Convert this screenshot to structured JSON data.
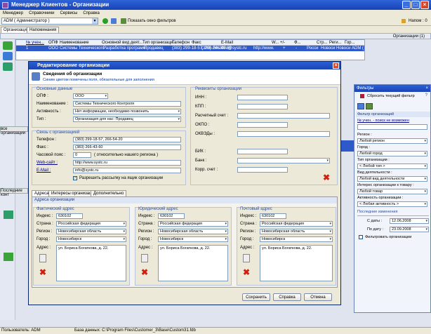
{
  "app": {
    "title": "Менеджер Клиентов - Организации"
  },
  "menu": [
    "Менеджер",
    "Справочники",
    "Сервисы",
    "Справка"
  ],
  "toolbar": {
    "user": "ADM ( Администратор )",
    "show_filters": "Показать окно фильтров",
    "naponm_label": "Напом : 0"
  },
  "tabs": [
    "Организации",
    "Напоминания"
  ],
  "strip_right": "Организации (1)",
  "grid": {
    "headers": [
      "№ учен...",
      "ОПФ",
      "Наименование",
      "Основной вид деят...",
      "Тип организаци...",
      "Телефон",
      "Факс",
      "E-Mail",
      "W...",
      "+/-",
      "Ф...",
      "Стр...",
      "Реги...",
      "Гор..."
    ],
    "row": [
      "1",
      "ООО",
      "Системы Технического",
      "Разработка программ",
      "Продавец",
      "(383) 299-18-57, 266-54-20",
      "(383) 266-43-60",
      "info@systc.ru",
      "http://www.",
      "+",
      "-",
      "Росси",
      "Новоси",
      "Новоси",
      "ADM ("
    ]
  },
  "dialog": {
    "title": "Редактирование организации",
    "head_title": "Сведения об организации",
    "head_sub": "Синим цветом помечены поля, обязательные для заполнения",
    "basic": {
      "legend": "Основные данные",
      "opf_label": "ОПФ :",
      "opf_value": "ООО",
      "name_label": "Наименование :",
      "name_value": "Системы Технического Контроля",
      "activity_label": "Активность :",
      "activity_value": "Нет информации, необходимо позвонить",
      "type_label": "Тип :",
      "type_value": "Организация для нас: Продавец"
    },
    "contact": {
      "legend": "Связь с организацией",
      "phone_label": "Телефон :",
      "phone_value": "(383) 299-18-57, 266-54-20",
      "fax_label": "Факс :",
      "fax_value": "(383) 266-43-60",
      "tz_label": "Часовой пояс :",
      "tz_value": "0",
      "tz_note": "( относительно нашего региона )",
      "web_label": "Web-сайт :",
      "web_value": "http://www.systc.ru",
      "email_label": "E-Mail :",
      "email_value": "info@systc.ru",
      "mail_allow": "Разрешить рассылку на ящик организации"
    },
    "requisites": {
      "legend": "Реквизиты организации",
      "inn": "ИНН :",
      "kpp": "КПП :",
      "account": "Расчетный счет :",
      "okpo": "ОКПО :",
      "okved": "ОКВЭДы :",
      "bik": "БИК :",
      "bank": "Банк :",
      "korr": "Корр. счет :"
    },
    "subtabs": [
      "Адреса",
      "Интересы организации",
      "Дополнительно"
    ],
    "addr_group": "Адреса организации",
    "addresses": [
      {
        "legend": "Фактический адрес",
        "index": "630102",
        "country": "Российская федерация",
        "region": "Новосибирская область",
        "city": "Новосибирск",
        "addr": "ул. Бориса Богаткова, д. 22."
      },
      {
        "legend": "Юридический адрес",
        "index": "630102",
        "country": "Российская федерация",
        "region": "Новосибирская область",
        "city": "Новосибирск",
        "addr": "ул. Бориса Богаткова, д. 22."
      },
      {
        "legend": "Почтовый адрес",
        "index": "630102",
        "country": "Российская федерация",
        "region": "Новосибирская область",
        "city": "Новосибирск",
        "addr": "ул. Бориса Богаткова, д. 22."
      }
    ],
    "addr_labels": {
      "index": "Индекс :",
      "country": "Страна :",
      "region": "Регион :",
      "city": "Город :",
      "addr": "Адрес :"
    },
    "buttons": {
      "save": "Сохранить",
      "help": "Справка",
      "cancel": "Отмена"
    }
  },
  "filters": {
    "title": "Фильтры",
    "reset": "Сбросить текущий фильтр",
    "section": "Фильтр организаций",
    "num_label": "№ учен. - поиск не возможен",
    "region_label": "Регион :",
    "region_value": "Любой регион",
    "city_label": "Город :",
    "city_value": "Любой город",
    "type_label": "Тип организации :",
    "type_value": "< Любой тип >",
    "activity_label": "Вид деятельности :",
    "activity_value": "Любой вид деятельности",
    "interest_label": "Интерес организации к товару :",
    "interest_value": "Любой товар",
    "active_label": "Активность организации :",
    "active_value": "< Любая активность >",
    "last_changes": "Последние изменения",
    "from_label": "С даты :",
    "from_value": "12.06.2008",
    "to_label": "По дату :",
    "to_value": "23.09.2008",
    "filter_date": "Фильтровать организации"
  },
  "left_panel_labels": [
    "все организации",
    "Последние конт"
  ],
  "status": {
    "user": "Пользователь: ADM",
    "db": "База данных: C:\\Program Files\\Customer_3\\Base\\Custom31.fdb"
  }
}
